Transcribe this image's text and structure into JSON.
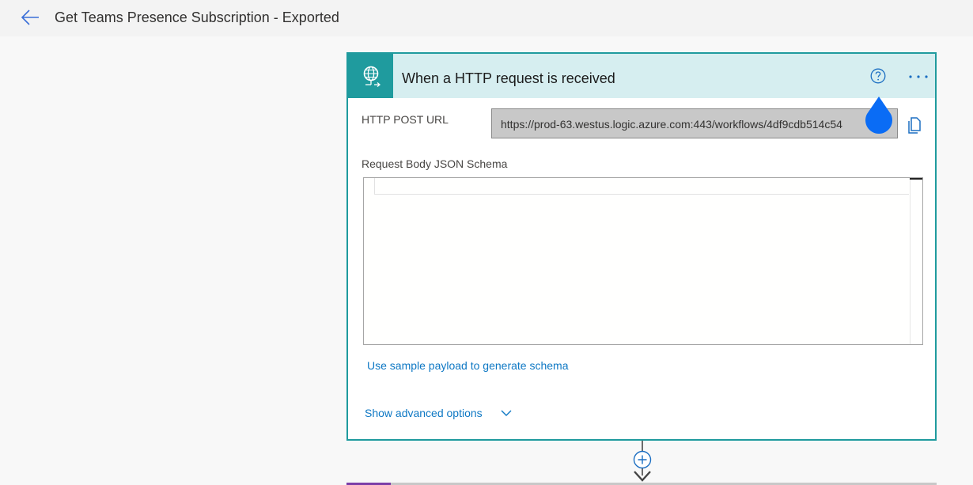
{
  "header": {
    "title": "Get Teams Presence Subscription - Exported"
  },
  "trigger_card": {
    "title": "When a HTTP request is received",
    "http_post_url_label": "HTTP POST URL",
    "http_post_url_value": "https://prod-63.westus.logic.azure.com:443/workflows/4df9cdb514c54",
    "schema_label": "Request Body JSON Schema",
    "schema_value": "",
    "sample_payload_link": "Use sample payload to generate schema",
    "advanced_options_link": "Show advanced options"
  },
  "icons": {
    "back": "back-arrow-icon",
    "trigger": "http-request-globe-icon",
    "help": "help-circle-icon",
    "more": "more-ellipsis-icon",
    "copy": "copy-icon",
    "advanced": "chevron-down-icon",
    "add_step": "plus-circle-icon",
    "connector": "arrow-down-icon"
  },
  "colors": {
    "accent_teal": "#1f9b9e",
    "header_bg": "#d6eef0",
    "link_blue": "#0e78c4",
    "touch_marker": "#0a6cf5",
    "next_card_accent": "#7b3ea8"
  }
}
